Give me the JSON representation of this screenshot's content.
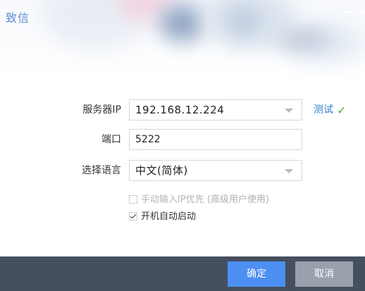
{
  "window": {
    "title": "致信",
    "minimize_icon": "minimize-icon",
    "close_icon": "close-icon",
    "close_glyph": "×"
  },
  "form": {
    "server_ip": {
      "label": "服务器IP",
      "value": "192.168.12.224",
      "test_label": "测试",
      "test_status_icon": "check-icon",
      "test_status_glyph": "✓",
      "test_status_color": "#4caf2e"
    },
    "port": {
      "label": "端口",
      "value": "5222"
    },
    "language": {
      "label": "选择语言",
      "value": "中文(简体)"
    },
    "manual_ip_priority": {
      "label": "手动输入IP优先",
      "hint": "(高级用户使用)",
      "checked": false
    },
    "auto_start": {
      "label": "开机自动启动",
      "checked": true
    }
  },
  "footer": {
    "ok_label": "确定",
    "cancel_label": "取消",
    "ok_color": "#4d8ef2",
    "cancel_color": "#9aa1ad",
    "bar_color": "#454f5e"
  },
  "colors": {
    "title": "#5a8fd0",
    "link": "#2f7fcf"
  }
}
